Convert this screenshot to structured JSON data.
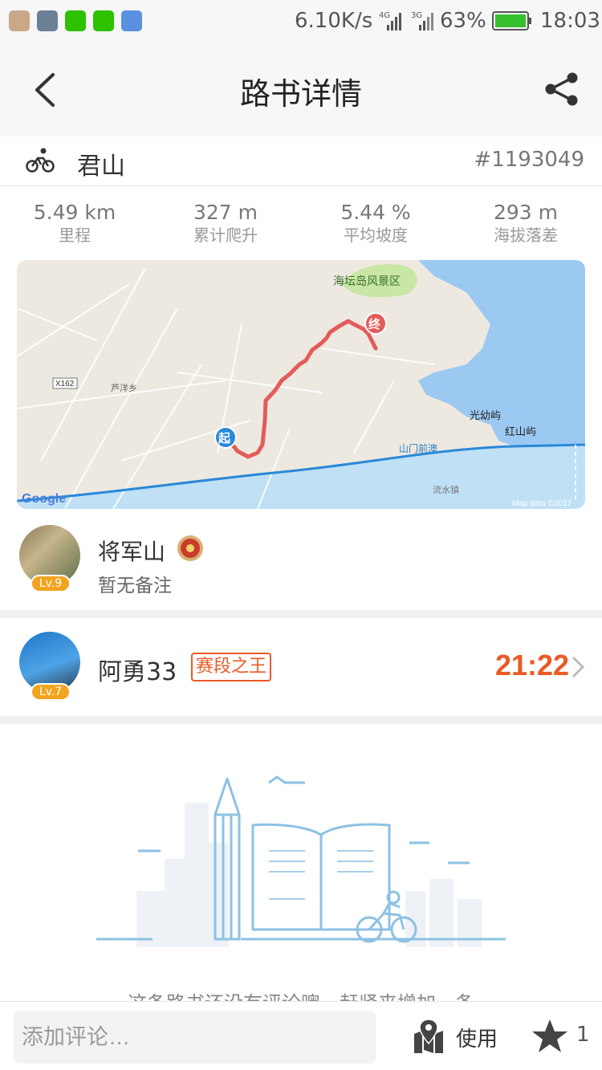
{
  "status_bar": {
    "net_speed": "6.10K/s",
    "battery": "63%",
    "time": "18:03",
    "sig1": "4G",
    "sig2": "3G"
  },
  "nav": {
    "title": "路书详情"
  },
  "route": {
    "name": "君山",
    "id": "#1193049"
  },
  "stats": [
    {
      "value": "5.49 km",
      "label": "里程"
    },
    {
      "value": "327 m",
      "label": "累计爬升"
    },
    {
      "value": "5.44 %",
      "label": "平均坡度"
    },
    {
      "value": "293 m",
      "label": "海拔落差"
    }
  ],
  "map": {
    "labels": {
      "scenic": "海坛岛风景区",
      "town": "芦洋乡",
      "road": "X162",
      "island1": "光幼屿",
      "island2": "红山屿",
      "bay": "山门前澳",
      "town2": "流水镇",
      "start": "起",
      "end": "终",
      "google": "Google",
      "attribution": "Map data ©2017"
    }
  },
  "creator": {
    "name": "将军山",
    "note": "暂无备注",
    "level": "Lv.9"
  },
  "record": {
    "name": "阿勇33",
    "badge": "赛段之王",
    "time": "21:22",
    "level": "Lv.7"
  },
  "comments": {
    "empty_text": "这条路书还没有评论噢，赶紧来增加一条"
  },
  "bottom_bar": {
    "comment_placeholder": "添加评论…",
    "use_label": "使用",
    "star_count": "1"
  },
  "colors": {
    "accent": "#ea5a24",
    "route_line": "#e35b5b",
    "level_badge": "#f3a41e",
    "water": "#9cc9f1"
  }
}
